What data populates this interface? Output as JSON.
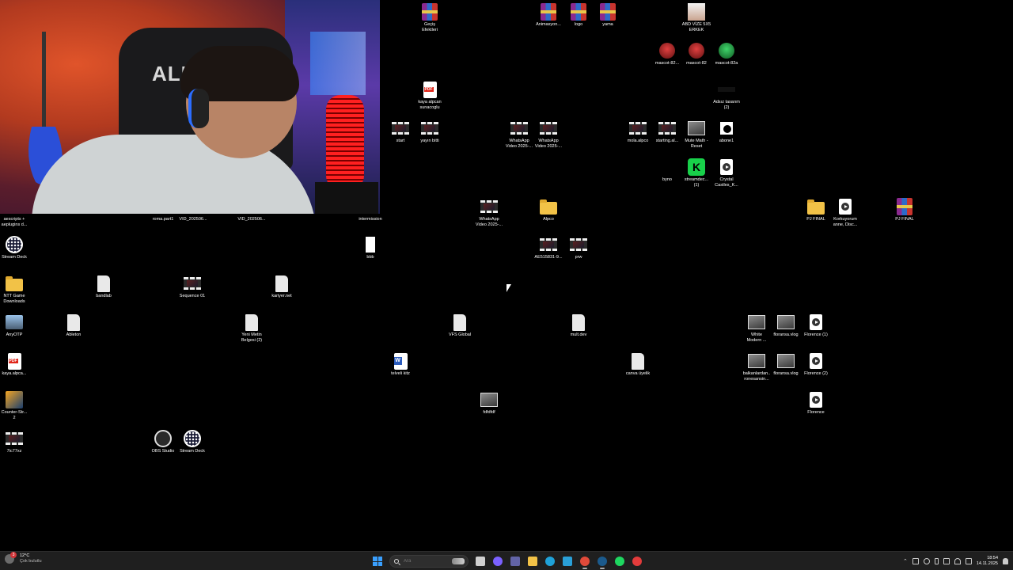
{
  "desktop": {
    "icons": [
      {
        "id": "gecis-efektleri",
        "label": "Geçiş\nEfektleri",
        "type": "rar"
      },
      {
        "id": "animasyon",
        "label": "Animasyon...",
        "type": "rar"
      },
      {
        "id": "logo",
        "label": "logo",
        "type": "rar"
      },
      {
        "id": "yama",
        "label": "yama",
        "type": "rar"
      },
      {
        "id": "abd-vize",
        "label": "ABD VİZE 5X5\nERKEK",
        "type": "avatar"
      },
      {
        "id": "mascot-82-copy",
        "label": "mascot-82...",
        "type": "mascot-red"
      },
      {
        "id": "mascot-82",
        "label": "mascot-82",
        "type": "mascot-red"
      },
      {
        "id": "mascot-82a",
        "label": "mascot-82a",
        "type": "mascot-green"
      },
      {
        "id": "kaya-pdf-1",
        "label": "kaya alpcan\nsunacoglu",
        "type": "pdf"
      },
      {
        "id": "adsiz-tasarim",
        "label": "Adsız tasarım\n(2)",
        "type": "blank"
      },
      {
        "id": "start",
        "label": "start",
        "type": "video"
      },
      {
        "id": "yayin-bitti",
        "label": "yayın bitti",
        "type": "video"
      },
      {
        "id": "whatsapp-1",
        "label": "WhatsApp\nVideo 2025-...",
        "type": "video"
      },
      {
        "id": "whatsapp-2",
        "label": "WhatsApp\nVideo 2025-...",
        "type": "video"
      },
      {
        "id": "mola-alpco",
        "label": "mola.alpco",
        "type": "video"
      },
      {
        "id": "starting-al",
        "label": "starting.al...",
        "type": "video"
      },
      {
        "id": "mute-math",
        "label": "Mute Math -\nReset",
        "type": "photo"
      },
      {
        "id": "abone1",
        "label": "abone1",
        "type": "abone"
      },
      {
        "id": "byno",
        "label": "byno",
        "type": "none"
      },
      {
        "id": "streamdeck-kick",
        "label": "streamdec...\n(1)",
        "type": "kick"
      },
      {
        "id": "crystal-castles",
        "label": "Crystal\nCastles_K...",
        "type": "play"
      },
      {
        "id": "aescripts",
        "label": "aescripts +\naeplugins d...",
        "type": "none"
      },
      {
        "id": "roma-part1",
        "label": "roma.part1",
        "type": "none"
      },
      {
        "id": "vid-2025-1",
        "label": "VID_202506...",
        "type": "none"
      },
      {
        "id": "vid-2025-2",
        "label": "VID_202506...",
        "type": "none"
      },
      {
        "id": "intermission",
        "label": "intermission",
        "type": "none"
      },
      {
        "id": "whatsapp-3",
        "label": "WhatsApp\nVideo 2025-...",
        "type": "video"
      },
      {
        "id": "alpco-folder",
        "label": "Alpco",
        "type": "folder"
      },
      {
        "id": "pj-final-folder",
        "label": "PJ FINAL",
        "type": "folder"
      },
      {
        "id": "korkuyorum",
        "label": "Korkuyorum\nanne, Disc...",
        "type": "play"
      },
      {
        "id": "pj-final-rar",
        "label": "PJ FINAL",
        "type": "rar"
      },
      {
        "id": "stream-deck-1",
        "label": "Stream Deck",
        "type": "streamdeck"
      },
      {
        "id": "bbb",
        "label": "bbb",
        "type": "bbb"
      },
      {
        "id": "ae515831",
        "label": "AE515831-9...",
        "type": "video"
      },
      {
        "id": "prw",
        "label": "prw",
        "type": "video"
      },
      {
        "id": "ntt-game",
        "label": "NTT Game\nDownloads",
        "type": "folder"
      },
      {
        "id": "bandlab",
        "label": "bandlab",
        "type": "doc"
      },
      {
        "id": "sequence-01",
        "label": "Sequence 01",
        "type": "video"
      },
      {
        "id": "kariyer-net",
        "label": "kariyer.net",
        "type": "doc"
      },
      {
        "id": "anyotp",
        "label": "AnyOTP",
        "type": "otp"
      },
      {
        "id": "ableton",
        "label": "Ableton",
        "type": "doc"
      },
      {
        "id": "yeni-metin",
        "label": "Yeni Metin\nBelgesi (2)",
        "type": "doc"
      },
      {
        "id": "vfs-global",
        "label": "VFS Global",
        "type": "doc"
      },
      {
        "id": "mult-dev",
        "label": "mult.dev",
        "type": "doc"
      },
      {
        "id": "white-modern",
        "label": "White\nModern ...",
        "type": "photo"
      },
      {
        "id": "floransa-vlog-1",
        "label": "floransa.vlog",
        "type": "photo"
      },
      {
        "id": "florence-1",
        "label": "Florence (1)",
        "type": "play"
      },
      {
        "id": "kaya-pdf-2",
        "label": "kaya.alpca...",
        "type": "pdf"
      },
      {
        "id": "telveli-kitz",
        "label": "telveli kitz",
        "type": "word"
      },
      {
        "id": "canva-uyelik",
        "label": "canva üyelik",
        "type": "doc"
      },
      {
        "id": "balkanlardan",
        "label": "balkanlardan..\nronesansin...",
        "type": "photo"
      },
      {
        "id": "floransa-vlog-2",
        "label": "floransa.vlog",
        "type": "photo"
      },
      {
        "id": "florence-2",
        "label": "Florence (2)",
        "type": "play"
      },
      {
        "id": "counter-strike",
        "label": "Counter-Str...\n2",
        "type": "game"
      },
      {
        "id": "fdfdfdf",
        "label": "fdfdfdf",
        "type": "photo"
      },
      {
        "id": "florence",
        "label": "Florence",
        "type": "play"
      },
      {
        "id": "7ic77xz",
        "label": "7ic77xz",
        "type": "video"
      },
      {
        "id": "obs-studio",
        "label": "OBS Studio",
        "type": "obs"
      },
      {
        "id": "stream-deck-2",
        "label": "Stream Deck",
        "type": "streamdeck"
      }
    ]
  },
  "webcam": {
    "chair_text": "ALPC"
  },
  "taskbar": {
    "weather": {
      "temp": "12°C",
      "condition": "Çok bulutlu",
      "badge": "3"
    },
    "search": {
      "placeholder": "Ara"
    },
    "apps": [
      {
        "name": "task-view",
        "color": "#cfcfcf"
      },
      {
        "name": "copilot",
        "color": "#7b61ff"
      },
      {
        "name": "teams",
        "color": "#6264a7"
      },
      {
        "name": "file-explorer",
        "color": "#f2c247"
      },
      {
        "name": "edge",
        "color": "#1fa2d9"
      },
      {
        "name": "calculator",
        "color": "#2aa0d8"
      },
      {
        "name": "chrome",
        "color": "#e04a3a"
      },
      {
        "name": "steam",
        "color": "#1b5a8c"
      },
      {
        "name": "spotify",
        "color": "#1ed760"
      },
      {
        "name": "record-app",
        "color": "#e23b3b"
      }
    ],
    "clock": {
      "time": "18:54",
      "date": "14.11.2025"
    }
  }
}
